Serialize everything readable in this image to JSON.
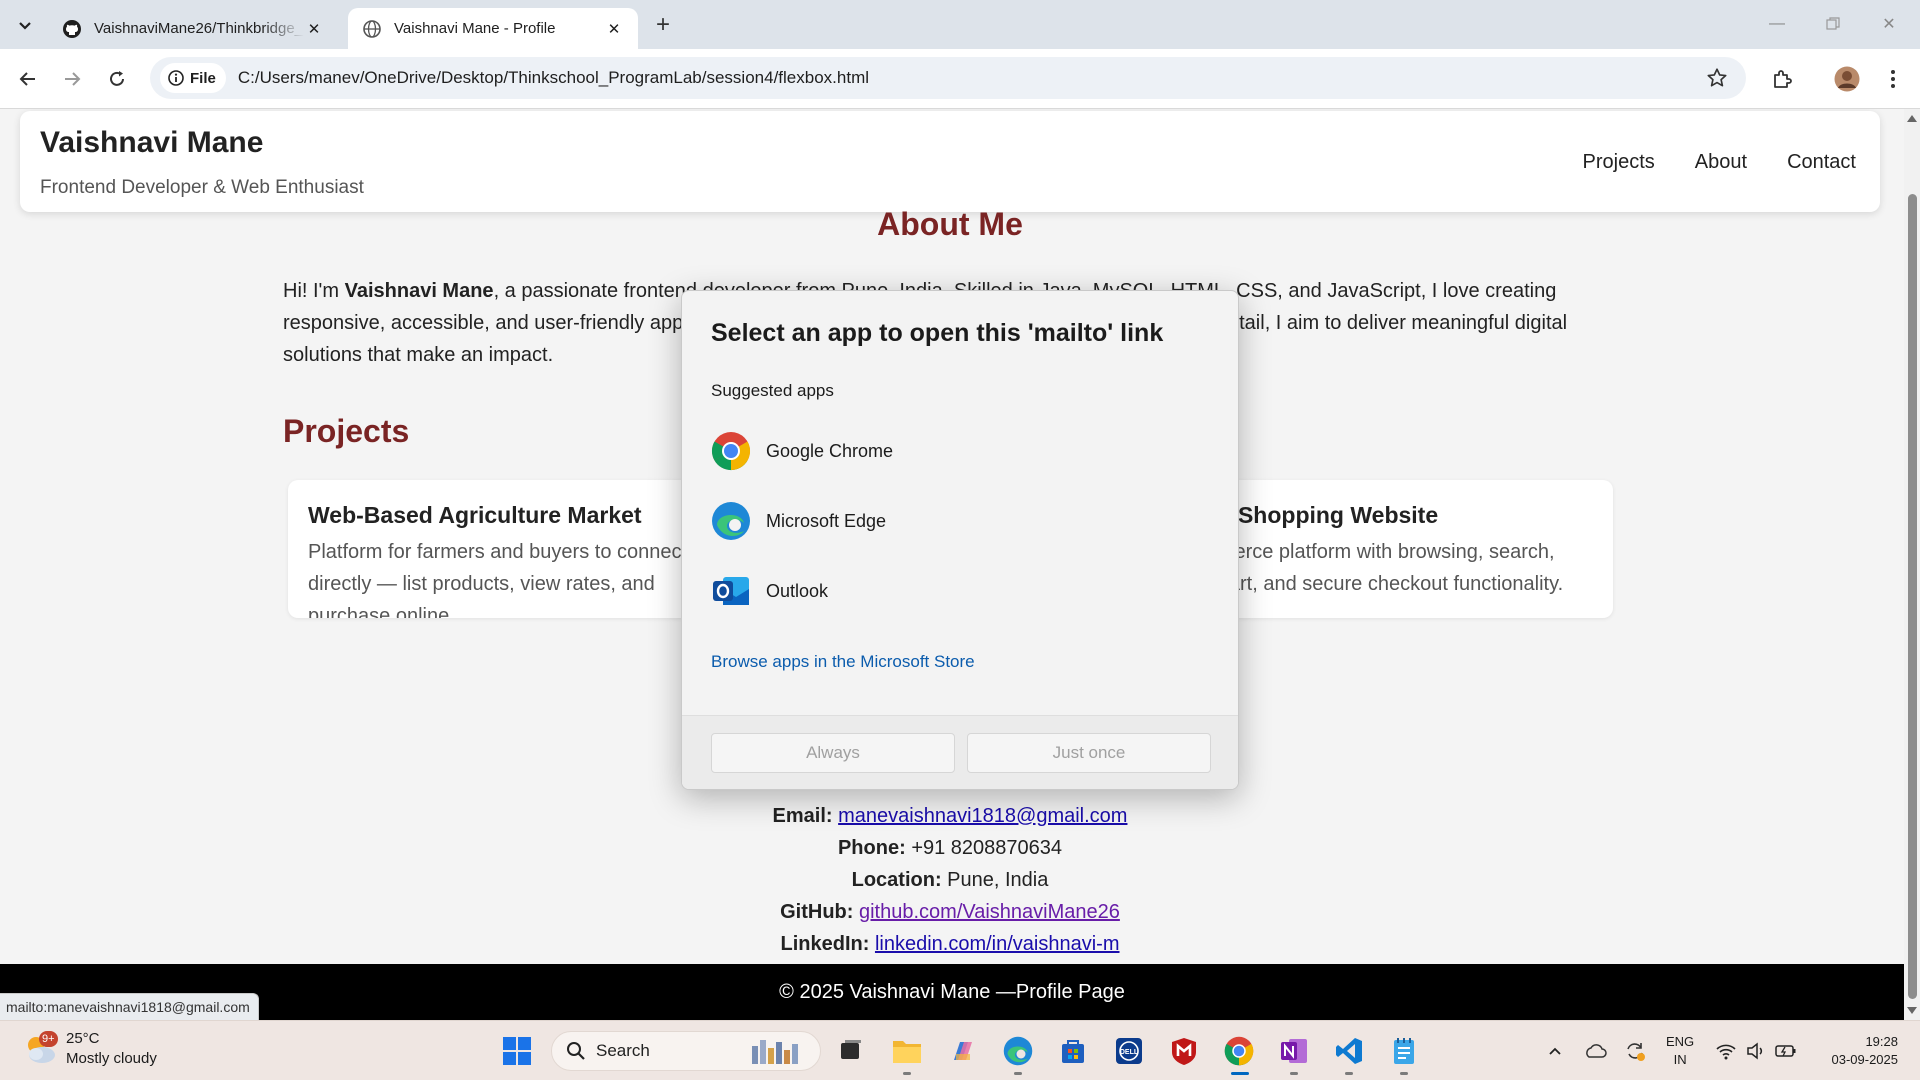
{
  "browser": {
    "tabs": [
      {
        "title": "VaishnaviMane26/Thinkbridge_"
      },
      {
        "title": "Vaishnavi Mane - Profile"
      }
    ],
    "address": {
      "chip": "File",
      "url": "C:/Users/manev/OneDrive/Desktop/Thinkschool_ProgramLab/session4/flexbox.html"
    }
  },
  "page": {
    "header": {
      "name": "Vaishnavi Mane",
      "tagline": "Frontend Developer & Web Enthusiast",
      "nav": [
        "Projects",
        "About",
        "Contact"
      ]
    },
    "about": {
      "heading": "About Me",
      "intro": "Hi! I'm ",
      "bold_name": "Vaishnavi Mane",
      "line1_rest": ", a passionate frontend developer from Pune, India. Skilled in Java, MySQL, HTML, CSS, and JavaScript, I love creating",
      "line2_left": "responsive, accessible, and user-friendly app",
      "line2_right": "etail, I aim to deliver meaningful digital",
      "line3": "solutions that make an impact."
    },
    "projects": {
      "heading": "Projects",
      "cards": [
        {
          "title": "Web-Based Agriculture Market",
          "desc": "Platform for farmers and buyers to connect directly — list products, view rates, and purchase online."
        },
        {
          "title": "Online Shopping Website",
          "desc": "E-commerce platform with browsing, search, filters, cart, and secure checkout functionality."
        }
      ]
    },
    "contact": {
      "email_label": "Email:",
      "email": "manevaishnavi1818@gmail.com",
      "phone_label": "Phone:",
      "phone": "+91 8208870634",
      "location_label": "Location:",
      "location": "Pune, India",
      "github_label": "GitHub:",
      "github": "github.com/VaishnaviMane26",
      "linkedin_label": "LinkedIn:",
      "linkedin": "linkedin.com/in/vaishnavi-m"
    },
    "footer": "© 2025 Vaishnavi Mane —Profile Page"
  },
  "status_bar": "mailto:manevaishnavi1818@gmail.com",
  "dialog": {
    "title": "Select an app to open this 'mailto' link",
    "subtitle": "Suggested apps",
    "apps": [
      "Google Chrome",
      "Microsoft Edge",
      "Outlook"
    ],
    "store_link": "Browse apps in the Microsoft Store",
    "always_button": "Always",
    "once_button": "Just once"
  },
  "taskbar": {
    "weather": {
      "temp": "25°C",
      "condition": "Mostly cloudy",
      "badge": "9+"
    },
    "search_placeholder": "Search",
    "lang_top": "ENG",
    "lang_bottom": "IN",
    "time": "19:28",
    "date": "03-09-2025"
  },
  "colors": {
    "heading_accent": "#7a2424",
    "link": "#1a0dab",
    "taskbar_bg": "#efe6e2"
  }
}
